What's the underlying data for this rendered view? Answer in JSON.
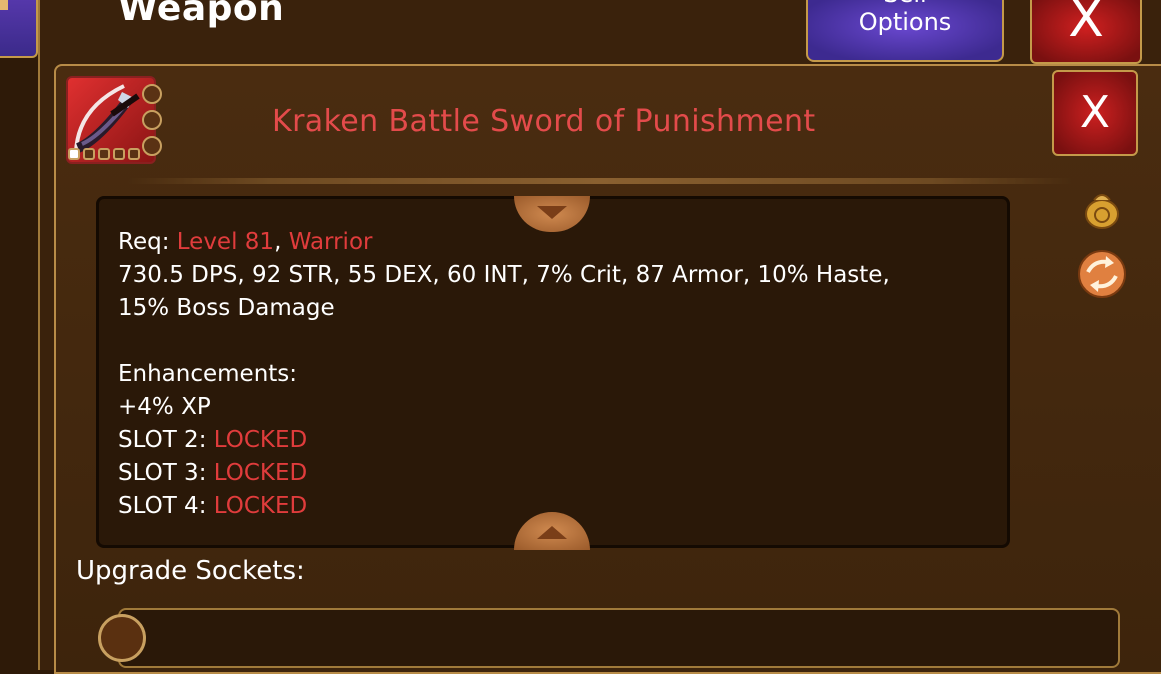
{
  "window": {
    "title": "Weapon",
    "sell_options_label_1": "Sell",
    "sell_options_label_2": "Options",
    "close_label": "X"
  },
  "item": {
    "name": "Kraken Battle Sword of Punishment",
    "close_label": "X",
    "req_label": "Req:",
    "req_level": "Level 81",
    "req_sep": ",",
    "req_class": "Warrior",
    "stats_line_1": "730.5 DPS, 92 STR, 55 DEX, 60 INT, 7% Crit, 87 Armor, 10% Haste,",
    "stats_line_2": "15% Boss Damage",
    "enhancements_title": "Enhancements:",
    "enhancements": [
      {
        "label": "+4% XP",
        "value": ""
      },
      {
        "label": "SLOT 2:",
        "value": "LOCKED"
      },
      {
        "label": "SLOT 3:",
        "value": "LOCKED"
      },
      {
        "label": "SLOT 4:",
        "value": "LOCKED"
      }
    ],
    "upgrade_sockets_label": "Upgrade Sockets:"
  },
  "colors": {
    "accent_red": "#e03c3c",
    "panel_brown": "#3d240c",
    "frame_gold": "#b88c48",
    "sell_purple": "#4a30a8"
  },
  "icons": [
    "sword-icon",
    "gem-slot-icon",
    "bag-icon",
    "refresh-icon",
    "scroll-up-icon",
    "scroll-down-icon",
    "socket-icon"
  ]
}
